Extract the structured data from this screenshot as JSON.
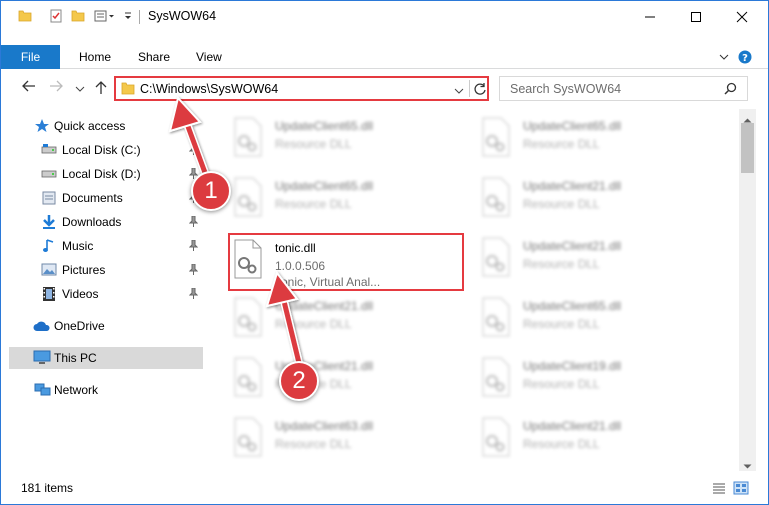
{
  "window": {
    "title": "SysWOW64"
  },
  "ribbon": {
    "file_tab": "File",
    "tabs": [
      "Home",
      "Share",
      "View"
    ]
  },
  "address": {
    "path": "C:\\Windows\\SysWOW64"
  },
  "search": {
    "placeholder": "Search SysWOW64"
  },
  "sidebar": {
    "items": [
      {
        "label": "Quick access",
        "icon": "star-icon"
      },
      {
        "label": "Local Disk (C:)",
        "icon": "drive-icon"
      },
      {
        "label": "Local Disk (D:)",
        "icon": "drive-icon"
      },
      {
        "label": "Documents",
        "icon": "documents-icon"
      },
      {
        "label": "Downloads",
        "icon": "download-icon"
      },
      {
        "label": "Music",
        "icon": "music-icon"
      },
      {
        "label": "Pictures",
        "icon": "pictures-icon"
      },
      {
        "label": "Videos",
        "icon": "videos-icon"
      },
      {
        "label": "OneDrive",
        "icon": "cloud-icon"
      },
      {
        "label": "This PC",
        "icon": "computer-icon"
      },
      {
        "label": "Network",
        "icon": "network-icon"
      }
    ]
  },
  "files": {
    "left": [
      {
        "name": "UpdateClient65.dll",
        "type": "Resource DLL"
      },
      {
        "name": "UpdateClient65.dll",
        "type": "Resource DLL"
      },
      {
        "name": "tonic.dll",
        "version": "1.0.0.506",
        "desc": "Tonic, Virtual Anal..."
      },
      {
        "name": "UpdateClient21.dll",
        "type": "Resource DLL"
      },
      {
        "name": "UpdateClient21.dll",
        "type": "Resource DLL"
      },
      {
        "name": "UpdateClient63.dll",
        "type": "Resource DLL"
      }
    ],
    "right": [
      {
        "name": "UpdateClient65.dll",
        "type": "Resource DLL"
      },
      {
        "name": "UpdateClient21.dll",
        "type": "Resource DLL"
      },
      {
        "name": "UpdateClient21.dll",
        "type": "Resource DLL"
      },
      {
        "name": "UpdateClient65.dll",
        "type": "Resource DLL"
      },
      {
        "name": "UpdateClient19.dll",
        "type": "Resource DLL"
      },
      {
        "name": "UpdateClient21.dll",
        "type": "Resource DLL"
      }
    ]
  },
  "status": {
    "items_count": "181 items"
  },
  "annotations": {
    "step1": "1",
    "step2": "2",
    "color": "#dc3b3f"
  },
  "colors": {
    "accent": "#1979ca",
    "highlight": "#e53a40"
  }
}
